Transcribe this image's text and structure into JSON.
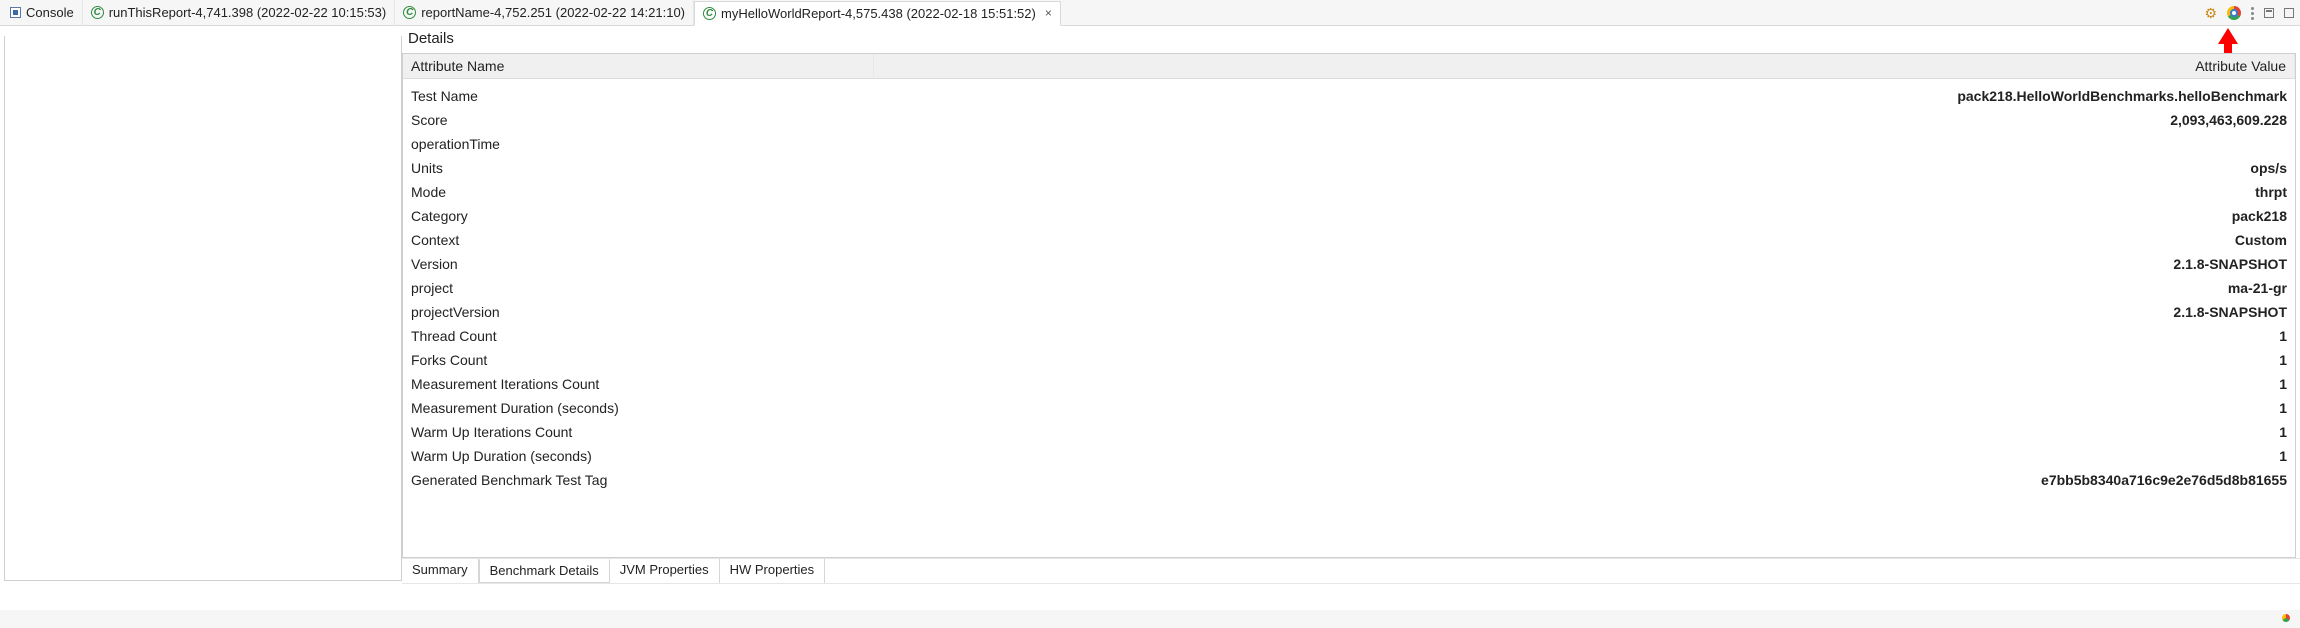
{
  "tabs": {
    "console": "Console",
    "items": [
      {
        "label": "runThisReport-4,741.398 (2022-02-22 10:15:53)"
      },
      {
        "label": "reportName-4,752.251 (2022-02-22 14:21:10)"
      },
      {
        "label": "myHelloWorldReport-4,575.438 (2022-02-18 15:51:52)"
      }
    ]
  },
  "details": {
    "title": "Details",
    "col_name": "Attribute Name",
    "col_value": "Attribute Value",
    "rows": [
      {
        "name": "Test Name",
        "value": "pack218.HelloWorldBenchmarks.helloBenchmark"
      },
      {
        "name": "Score",
        "value": "2,093,463,609.228"
      },
      {
        "name": "operationTime",
        "value": ""
      },
      {
        "name": "Units",
        "value": "ops/s"
      },
      {
        "name": "Mode",
        "value": "thrpt"
      },
      {
        "name": "Category",
        "value": "pack218"
      },
      {
        "name": "Context",
        "value": "Custom"
      },
      {
        "name": "Version",
        "value": "2.1.8-SNAPSHOT"
      },
      {
        "name": "project",
        "value": "ma-21-gr"
      },
      {
        "name": "projectVersion",
        "value": "2.1.8-SNAPSHOT"
      },
      {
        "name": "Thread Count",
        "value": "1"
      },
      {
        "name": "Forks Count",
        "value": "1"
      },
      {
        "name": "Measurement Iterations Count",
        "value": "1"
      },
      {
        "name": "Measurement Duration (seconds)",
        "value": "1"
      },
      {
        "name": "Warm Up Iterations Count",
        "value": "1"
      },
      {
        "name": "Warm Up Duration (seconds)",
        "value": "1"
      },
      {
        "name": "Generated Benchmark Test Tag",
        "value": "e7bb5b8340a716c9e2e76d5d8b81655"
      }
    ]
  },
  "bottom_tabs": {
    "summary": "Summary",
    "benchmark_details": "Benchmark Details",
    "jvm": "JVM Properties",
    "hw": "HW Properties"
  }
}
